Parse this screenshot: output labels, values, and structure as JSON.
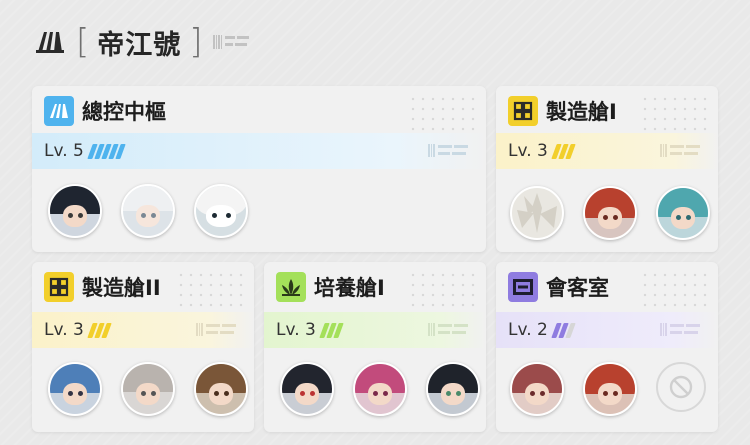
{
  "base": {
    "title": "帝江號"
  },
  "rooms": {
    "control": {
      "name": "總控中樞",
      "level": "Lv. 5",
      "level_value": 5,
      "max_pips": 5,
      "color": "#4fb3ee"
    },
    "mfg1": {
      "name": "製造艙I",
      "level": "Lv. 3",
      "level_value": 3,
      "max_pips": 3,
      "color": "#f2cf2b"
    },
    "mfg2": {
      "name": "製造艙II",
      "level": "Lv. 3",
      "level_value": 3,
      "max_pips": 3,
      "color": "#f2cf2b"
    },
    "grow1": {
      "name": "培養艙I",
      "level": "Lv. 3",
      "level_value": 3,
      "max_pips": 3,
      "color": "#a4e05a"
    },
    "guest": {
      "name": "會客室",
      "level": "Lv. 2",
      "level_value": 2,
      "max_pips": 3,
      "color": "#8f7ce0"
    }
  },
  "icons": {
    "logo": "endfield-logo-icon",
    "control": "control-hub-icon",
    "manufacturing": "manufacturing-icon",
    "growth": "growth-plant-icon",
    "reception": "reception-room-icon",
    "empty": "empty-slot-icon"
  }
}
